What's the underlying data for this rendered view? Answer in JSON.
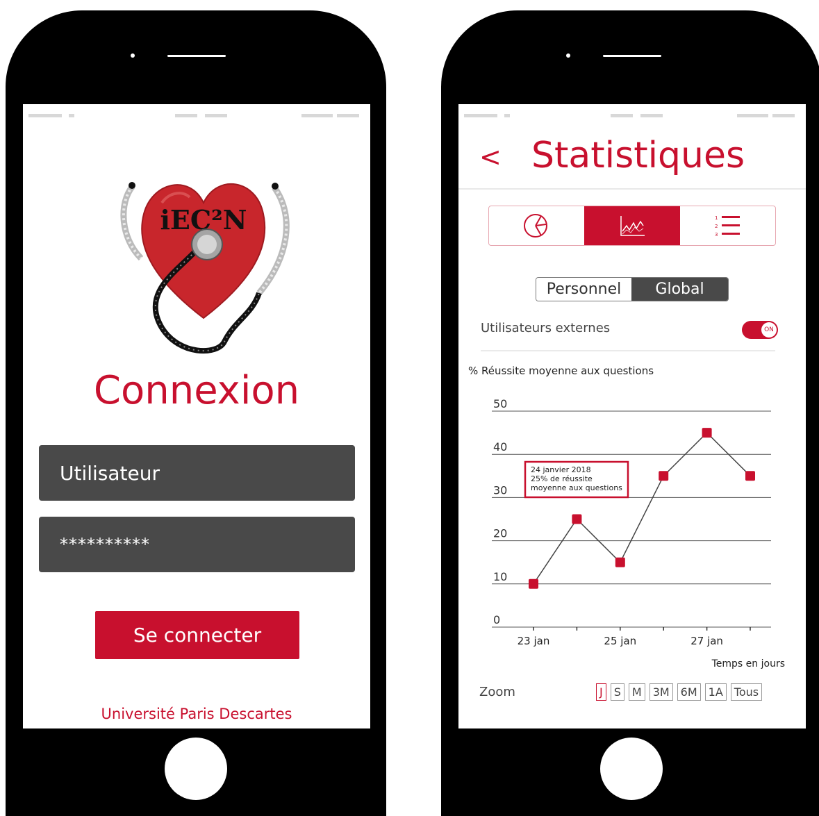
{
  "login": {
    "logo_text": "iEC²N",
    "title": "Connexion",
    "username_value": "Utilisateur",
    "password_value": "**********",
    "submit_label": "Se connecter",
    "footer_link": "Université Paris Descartes"
  },
  "stats": {
    "back_label": "<",
    "title": "Statistiques",
    "view_tabs": [
      {
        "icon": "pie-chart-icon",
        "active": false
      },
      {
        "icon": "line-chart-icon",
        "active": true
      },
      {
        "icon": "numbered-list-icon",
        "active": false
      }
    ],
    "scope": {
      "personnel": "Personnel",
      "global": "Global",
      "selected": "Global"
    },
    "external_users": {
      "label": "Utilisateurs externes",
      "state": "ON"
    },
    "zoom": {
      "label": "Zoom",
      "options": [
        "J",
        "S",
        "M",
        "3M",
        "6M",
        "1A",
        "Tous"
      ],
      "selected": "J"
    }
  },
  "colors": {
    "accent": "#c8102e",
    "dark_field": "#494949",
    "line": "#444444"
  },
  "chart_data": {
    "type": "line",
    "title": "% Réussite moyenne aux questions",
    "xlabel": "Temps en jours",
    "ylabel": "",
    "x_tick_labels": [
      "23 jan",
      "25 jan",
      "27 jan"
    ],
    "x": [
      "23 jan",
      "24 jan",
      "25 jan",
      "26 jan",
      "27 jan",
      "28 jan"
    ],
    "values": [
      10,
      25,
      15,
      35,
      45,
      35
    ],
    "yticks": [
      0,
      10,
      20,
      30,
      40,
      50
    ],
    "ylim": [
      0,
      50
    ],
    "grid": true,
    "tooltip": {
      "point": "24 jan",
      "lines": [
        "24 janvier 2018",
        "25% de réussite",
        "moyenne aux questions"
      ]
    }
  }
}
